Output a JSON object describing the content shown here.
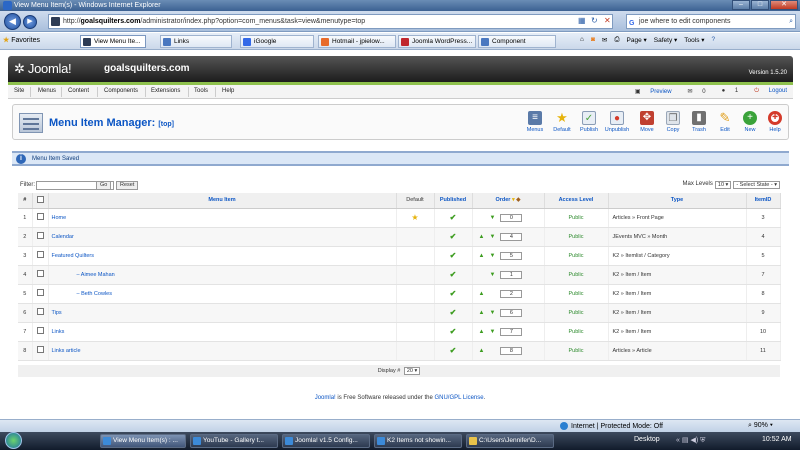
{
  "browser": {
    "title": "View Menu Item(s) - Windows Internet Explorer",
    "address_host": "goalsquilters.com",
    "address_path": "/administrator/index.php?option=com_menus&task=view&menutype=top",
    "address_prefix": "http://",
    "search_text": "joe where to edit components",
    "favorites_label": "Favorites",
    "tabs": [
      "View Menu Ite...",
      "Links",
      "iGoogle",
      "Hotmail - jpielow...",
      "Joomla WordPress...",
      "Component"
    ],
    "commands": [
      "Page ▾",
      "Safety ▾",
      "Tools ▾"
    ],
    "status_zone": "Internet | Protected Mode: Off",
    "zoom": "90%"
  },
  "joomla": {
    "logo": "Joomla!",
    "site_name": "goalsquilters.com",
    "version": "Version 1.5.20",
    "menu": [
      "Site",
      "Menus",
      "Content",
      "Components",
      "Extensions",
      "Tools",
      "Help"
    ],
    "status": {
      "preview": "Preview",
      "messages": "0",
      "users": "1",
      "logout": "Logout"
    }
  },
  "manager": {
    "title": "Menu Item Manager:",
    "subtitle": "[top]",
    "toolbar": [
      {
        "label": "Menus",
        "icon": "menus-icon",
        "color": "#5a7aa8"
      },
      {
        "label": "Default",
        "icon": "star-icon",
        "color": "#e6b30c"
      },
      {
        "label": "Publish",
        "icon": "publish-icon",
        "color": "#4aa33a"
      },
      {
        "label": "Unpublish",
        "icon": "unpublish-icon",
        "color": "#d43a2a"
      },
      {
        "label": "Move",
        "icon": "move-icon",
        "color": "#c04030"
      },
      {
        "label": "Copy",
        "icon": "copy-icon",
        "color": "#9aa7b8"
      },
      {
        "label": "Trash",
        "icon": "trash-icon",
        "color": "#707070"
      },
      {
        "label": "Edit",
        "icon": "edit-icon",
        "color": "#e0a020"
      },
      {
        "label": "New",
        "icon": "new-icon",
        "color": "#3aa33a"
      },
      {
        "label": "Help",
        "icon": "help-icon",
        "color": "#d43a2a"
      }
    ],
    "message": "Menu Item Saved",
    "filter_label": "Filter:",
    "go_label": "Go",
    "reset_label": "Reset",
    "max_levels_label": "Max Levels",
    "max_levels_value": "10",
    "state_select": "- Select State -",
    "columns": [
      "#",
      "",
      "Menu Item",
      "Default",
      "Published",
      "Order",
      "Access Level",
      "Type",
      "ItemID"
    ],
    "rows": [
      {
        "num": "1",
        "name": "Home",
        "default": true,
        "up": false,
        "down": true,
        "order": "0",
        "access": "Public",
        "type": "Articles » Front Page",
        "itemid": "3"
      },
      {
        "num": "2",
        "name": "Calendar",
        "default": false,
        "up": true,
        "down": true,
        "order": "4",
        "access": "Public",
        "type": "JEvents MVC » Month",
        "itemid": "4"
      },
      {
        "num": "3",
        "name": "Featured Quilters",
        "default": false,
        "up": true,
        "down": true,
        "order": "5",
        "access": "Public",
        "type": "K2 » Itemlist / Category",
        "itemid": "5"
      },
      {
        "num": "4",
        "name": "– Aimee Mahan",
        "default": false,
        "up": false,
        "down": true,
        "order": "1",
        "access": "Public",
        "type": "K2 » Item / Item",
        "itemid": "7"
      },
      {
        "num": "5",
        "name": "– Beth Cowles",
        "default": false,
        "up": true,
        "down": false,
        "order": "2",
        "access": "Public",
        "type": "K2 » Item / Item",
        "itemid": "8"
      },
      {
        "num": "6",
        "name": "Tips",
        "default": false,
        "up": true,
        "down": true,
        "order": "6",
        "access": "Public",
        "type": "K2 » Item / Item",
        "itemid": "9"
      },
      {
        "num": "7",
        "name": "Links",
        "default": false,
        "up": true,
        "down": true,
        "order": "7",
        "access": "Public",
        "type": "K2 » Item / Item",
        "itemid": "10"
      },
      {
        "num": "8",
        "name": "Links article",
        "default": false,
        "up": true,
        "down": false,
        "order": "8",
        "access": "Public",
        "type": "Articles » Article",
        "itemid": "11"
      }
    ],
    "display_label": "Display #",
    "display_value": "20",
    "footer_pre": "Joomla!",
    "footer_mid": " is Free Software released under the ",
    "footer_link": "GNU/GPL License",
    "footer_post": "."
  },
  "taskbar": {
    "items": [
      "View Menu Item(s) : ...",
      "YouTube - Gallery t...",
      "Joomla! v1.5 Config...",
      "K2 Items not showin...",
      "C:\\Users\\Jennifer\\D..."
    ],
    "desktop": "Desktop",
    "time": "10:52 AM"
  }
}
